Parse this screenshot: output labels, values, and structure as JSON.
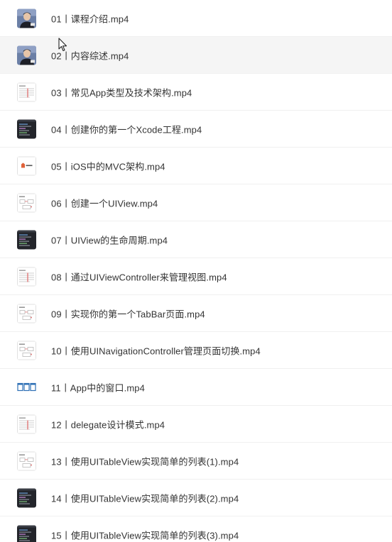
{
  "files": [
    {
      "name": "01丨课程介绍.mp4",
      "thumb": "video-person-thumbnail"
    },
    {
      "name": "02丨内容综述.mp4",
      "thumb": "video-person-thumbnail"
    },
    {
      "name": "03丨常见App类型及技术架构.mp4",
      "thumb": "slide-table-thumbnail"
    },
    {
      "name": "04丨创建你的第一个Xcode工程.mp4",
      "thumb": "code-editor-thumbnail"
    },
    {
      "name": "05丨iOS中的MVC架构.mp4",
      "thumb": "logo-slide-thumbnail"
    },
    {
      "name": "06丨创建一个UIView.mp4",
      "thumb": "slide-diagram-thumbnail"
    },
    {
      "name": "07丨UIView的生命周期.mp4",
      "thumb": "code-editor-thumbnail"
    },
    {
      "name": "08丨通过UIViewController来管理视图.mp4",
      "thumb": "slide-table-thumbnail"
    },
    {
      "name": "09丨实现你的第一个TabBar页面.mp4",
      "thumb": "slide-diagram-thumbnail"
    },
    {
      "name": "10丨使用UINavigationController管理页面切换.mp4",
      "thumb": "slide-diagram-thumbnail"
    },
    {
      "name": "11丨App中的窗口.mp4",
      "thumb": "window-diagram-thumbnail"
    },
    {
      "name": "12丨delegate设计模式.mp4",
      "thumb": "slide-table-thumbnail"
    },
    {
      "name": "13丨使用UITableView实现简单的列表(1).mp4",
      "thumb": "slide-diagram-thumbnail"
    },
    {
      "name": "14丨使用UITableView实现简单的列表(2).mp4",
      "thumb": "code-editor-thumbnail"
    },
    {
      "name": "15丨使用UITableView实现简单的列表(3).mp4",
      "thumb": "code-editor-thumbnail"
    }
  ],
  "hovered_index": 1,
  "colors": {
    "text": "#333333",
    "hover_bg": "#f5f5f5",
    "divider": "#f0f0f0"
  }
}
